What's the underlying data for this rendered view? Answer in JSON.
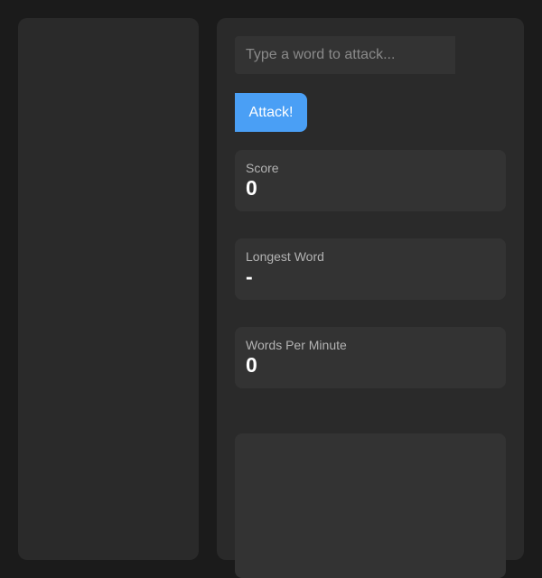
{
  "input": {
    "placeholder": "Type a word to attack...",
    "value": ""
  },
  "attack_button": {
    "label": "Attack!"
  },
  "stats": {
    "score": {
      "label": "Score",
      "value": "0"
    },
    "longest_word": {
      "label": "Longest Word",
      "value": "-"
    },
    "words_per_minute": {
      "label": "Words Per Minute",
      "value": "0"
    }
  },
  "colors": {
    "background": "#1b1b1b",
    "panel": "#2a2a2a",
    "card": "#333333",
    "accent": "#4a9ff5"
  }
}
